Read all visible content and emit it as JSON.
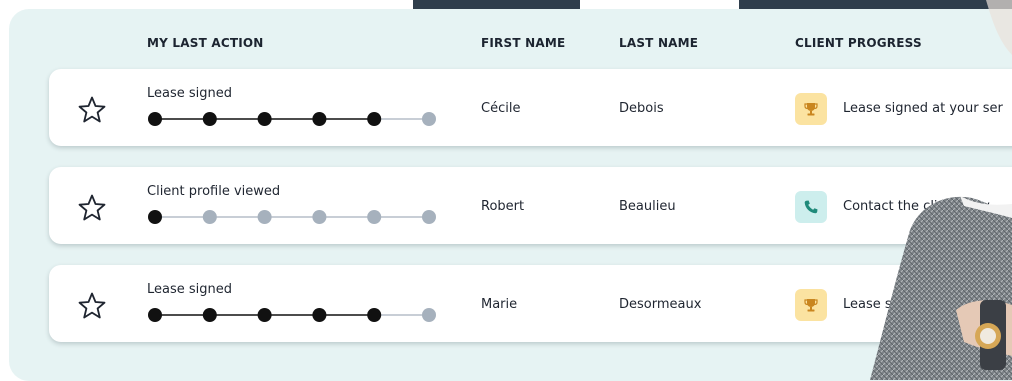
{
  "table": {
    "headers": {
      "action": "MY LAST ACTION",
      "first": "FIRST NAME",
      "last": "LAST NAME",
      "progress": "CLIENT PROGRESS"
    },
    "rows": [
      {
        "favorite": false,
        "action": "Lease signed",
        "steps_completed": 5,
        "steps_total": 6,
        "first": "Cécile",
        "last": "Debois",
        "progress_icon": "trophy-icon",
        "progress": "Lease signed at your ser"
      },
      {
        "favorite": false,
        "action": "Client profile viewed",
        "steps_completed": 1,
        "steps_total": 6,
        "first": "Robert",
        "last": "Beaulieu",
        "progress_icon": "phone-icon",
        "progress": "Contact the client now"
      },
      {
        "favorite": false,
        "action": "Lease signed",
        "steps_completed": 5,
        "steps_total": 6,
        "first": "Marie",
        "last": "Desormeaux",
        "progress_icon": "trophy-icon",
        "progress": "Lease s"
      }
    ]
  },
  "colors": {
    "panel_bg": "#e6f3f3",
    "step_done": "#111111",
    "step_todo": "#a6b1bd",
    "trophy_bg": "#fbe3a1",
    "trophy": "#c9861f",
    "phone_bg": "#cdeeed",
    "phone": "#1f8a7a",
    "tab_dark": "#2f3e4c"
  }
}
